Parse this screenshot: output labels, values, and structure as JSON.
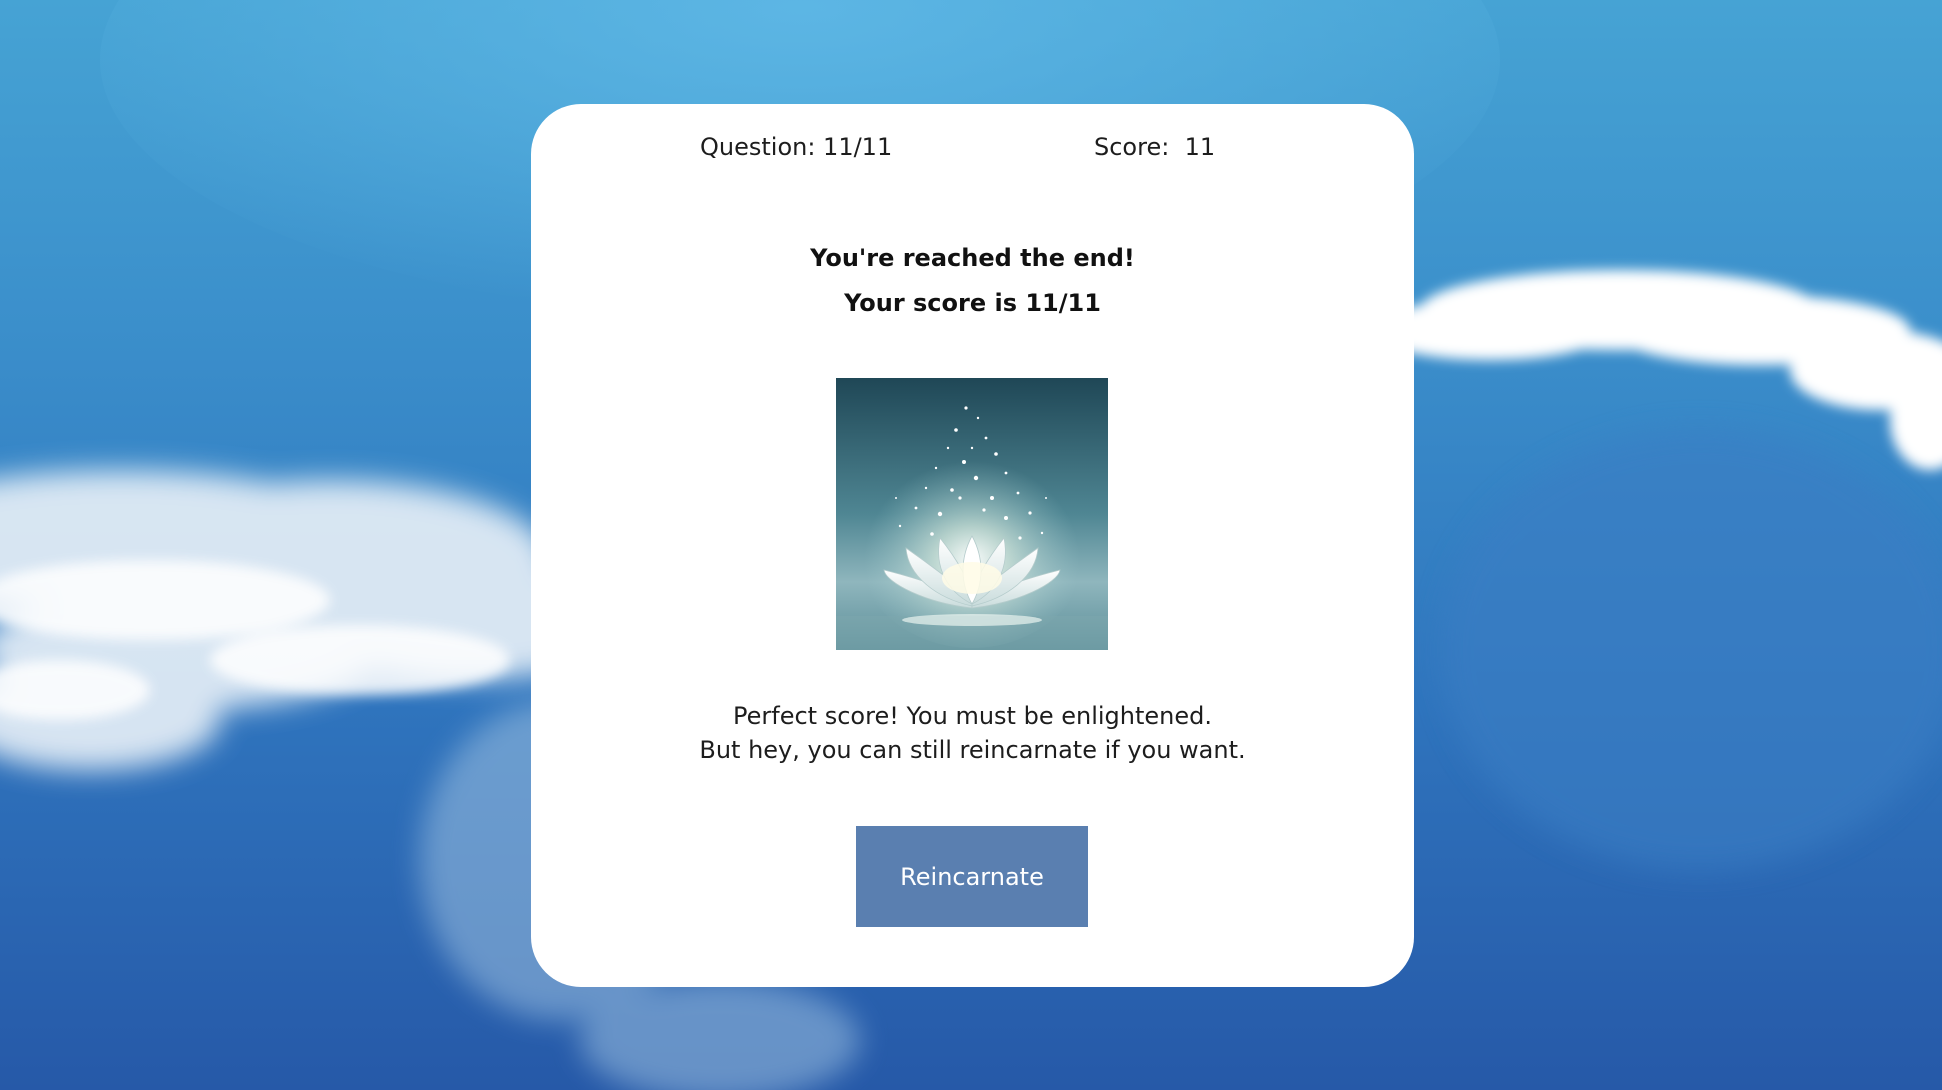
{
  "header": {
    "question_text": "Question: 11/11",
    "score_text": "Score:  11"
  },
  "result": {
    "heading": "You're reached the end!",
    "score_line": "Your score is 11/11",
    "message_line_1": "Perfect score! You must be enlightened.",
    "message_line_2": "But hey, you can still reincarnate if you want."
  },
  "actions": {
    "reincarnate_label": "Reincarnate"
  },
  "colors": {
    "button": "#5a7fb0",
    "card": "#ffffff",
    "sky_top": "#46a3d4",
    "sky_bottom": "#2659a8"
  },
  "image": {
    "name": "lotus-image"
  }
}
